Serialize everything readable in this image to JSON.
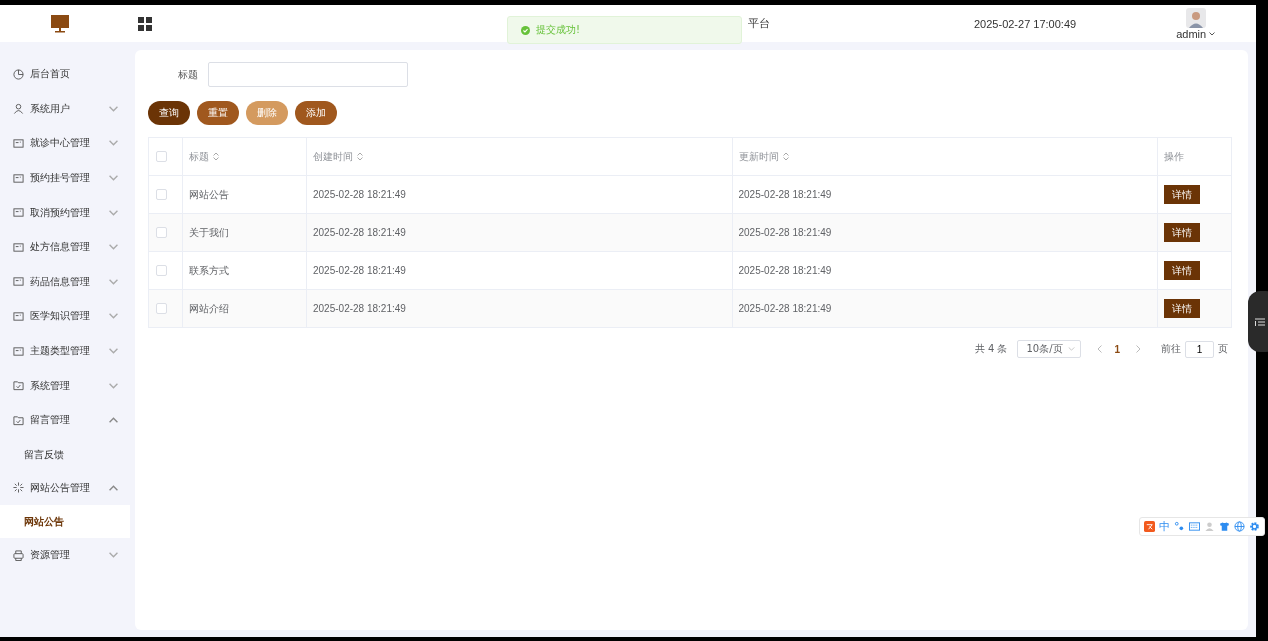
{
  "header": {
    "title": "平台",
    "datetime": "2025-02-27 17:00:49",
    "user": "admin"
  },
  "toast": {
    "message": "提交成功!"
  },
  "sidebar": {
    "items": [
      {
        "label": "后台首页",
        "kind": "link"
      },
      {
        "label": "系统用户",
        "kind": "group",
        "expanded": false
      },
      {
        "label": "就诊中心管理",
        "kind": "group",
        "expanded": false
      },
      {
        "label": "预约挂号管理",
        "kind": "group",
        "expanded": false
      },
      {
        "label": "取消预约管理",
        "kind": "group",
        "expanded": false
      },
      {
        "label": "处方信息管理",
        "kind": "group",
        "expanded": false
      },
      {
        "label": "药品信息管理",
        "kind": "group",
        "expanded": false
      },
      {
        "label": "医学知识管理",
        "kind": "group",
        "expanded": false
      },
      {
        "label": "主题类型管理",
        "kind": "group",
        "expanded": false
      },
      {
        "label": "系统管理",
        "kind": "group",
        "expanded": false
      },
      {
        "label": "留言管理",
        "kind": "group",
        "expanded": true,
        "children": [
          {
            "label": "留言反馈",
            "selected": false
          }
        ]
      },
      {
        "label": "网站公告管理",
        "kind": "group",
        "expanded": true,
        "children": [
          {
            "label": "网站公告",
            "selected": true
          }
        ]
      },
      {
        "label": "资源管理",
        "kind": "group",
        "expanded": false
      }
    ]
  },
  "search": {
    "label": "标题"
  },
  "buttons": [
    {
      "label": "查询",
      "kind": "primary",
      "disabled": false
    },
    {
      "label": "重置",
      "kind": "secondary",
      "disabled": false
    },
    {
      "label": "删除",
      "kind": "secondary",
      "disabled": true
    },
    {
      "label": "添加",
      "kind": "secondary",
      "disabled": false
    }
  ],
  "table": {
    "select_all_checked": false,
    "columns": [
      {
        "label": "标题",
        "sortable": true
      },
      {
        "label": "创建时间",
        "sortable": true
      },
      {
        "label": "更新时间",
        "sortable": true
      },
      {
        "label": "操作",
        "sortable": false
      }
    ],
    "rows": [
      {
        "checked": false,
        "title": "网站公告",
        "created": "2025-02-28 18:21:49",
        "updated": "2025-02-28 18:21:49",
        "action": "详情"
      },
      {
        "checked": false,
        "title": "关于我们",
        "created": "2025-02-28 18:21:49",
        "updated": "2025-02-28 18:21:49",
        "action": "详情"
      },
      {
        "checked": false,
        "title": "联系方式",
        "created": "2025-02-28 18:21:49",
        "updated": "2025-02-28 18:21:49",
        "action": "详情"
      },
      {
        "checked": false,
        "title": "网站介绍",
        "created": "2025-02-28 18:21:49",
        "updated": "2025-02-28 18:21:49",
        "action": "详情"
      }
    ]
  },
  "pagination": {
    "total": "共 4 条",
    "page_size": "10条/页",
    "pages": [
      {
        "label": "1",
        "selected": true
      }
    ],
    "goto_label": "前往",
    "goto_value": "1",
    "goto_suffix": "页"
  },
  "ime_bar": {
    "mode": "中"
  }
}
